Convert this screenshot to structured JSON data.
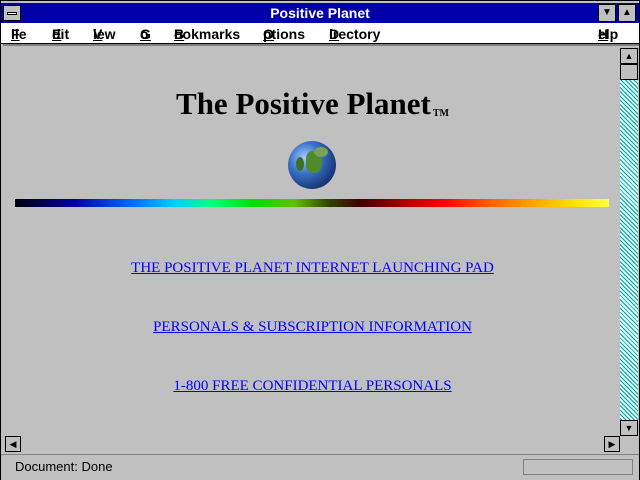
{
  "window": {
    "title": "Positive Planet"
  },
  "menu": {
    "items": [
      {
        "u": "F",
        "rest": "ile"
      },
      {
        "u": "E",
        "rest": "dit"
      },
      {
        "u": "V",
        "rest": "iew"
      },
      {
        "u": "G",
        "rest": "o"
      },
      {
        "u": "B",
        "rest": "ookmarks"
      },
      {
        "u": "O",
        "rest": "ptions"
      },
      {
        "u": "D",
        "rest": "irectory"
      },
      {
        "u": "H",
        "rest": "elp"
      }
    ]
  },
  "page": {
    "heading": "The Positive Planet",
    "trademark": "TM",
    "links": [
      "THE POSITIVE PLANET INTERNET LAUNCHING PAD",
      "PERSONALS & SUBSCRIPTION INFORMATION",
      "1-800 FREE CONFIDENTIAL PERSONALS"
    ]
  },
  "status": {
    "text": "Document: Done"
  },
  "icons": {
    "system_menu": "system-menu-icon",
    "minimize": "minimize-arrow-icon",
    "maximize": "maximize-arrow-icon",
    "globe": "globe-icon",
    "scroll_up": "up-arrow-icon",
    "scroll_down": "down-arrow-icon",
    "scroll_left": "left-arrow-icon",
    "scroll_right": "right-arrow-icon"
  },
  "colors": {
    "title_bar": "#0000a8",
    "link": "#0000ff",
    "background": "#c0c0c0"
  }
}
